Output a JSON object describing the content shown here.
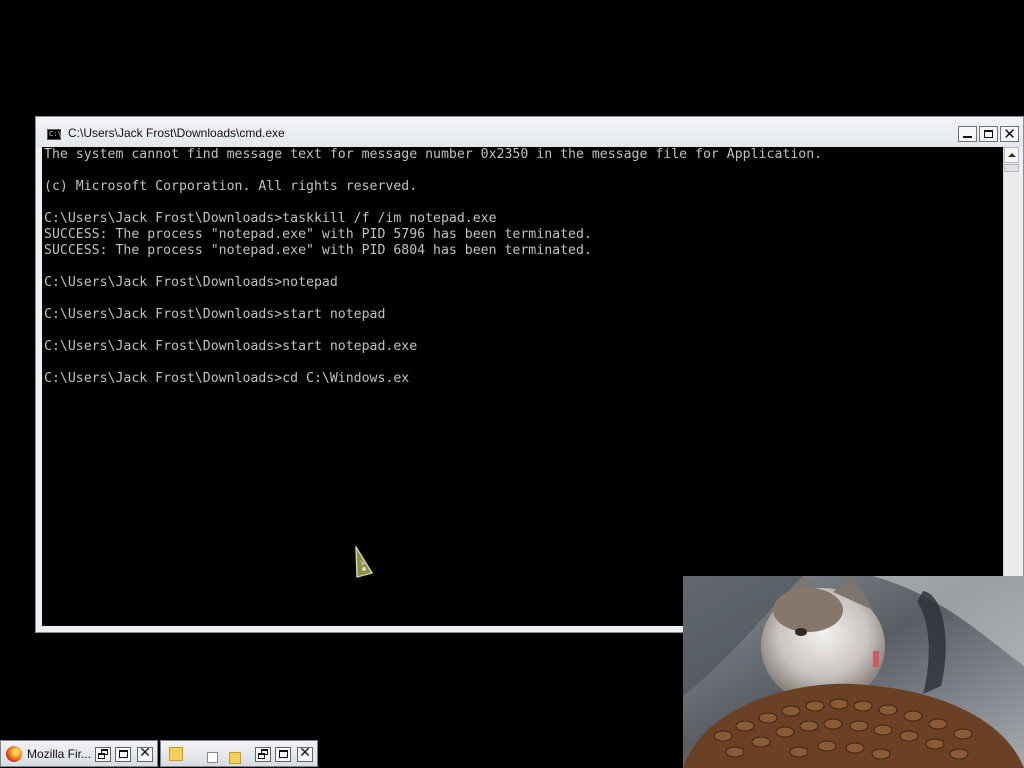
{
  "window": {
    "title": "C:\\Users\\Jack Frost\\Downloads\\cmd.exe",
    "icon_text": "C:\\",
    "minimize_symbol": "",
    "close_symbol": "✕"
  },
  "console": {
    "lines": [
      "The system cannot find message text for message number 0x2350 in the message file for Application.",
      "",
      "(c) Microsoft Corporation. All rights reserved.",
      "",
      "C:\\Users\\Jack Frost\\Downloads>taskkill /f /im notepad.exe",
      "SUCCESS: The process \"notepad.exe\" with PID 5796 has been terminated.",
      "SUCCESS: The process \"notepad.exe\" with PID 6804 has been terminated.",
      "",
      "C:\\Users\\Jack Frost\\Downloads>notepad",
      "",
      "C:\\Users\\Jack Frost\\Downloads>start notepad",
      "",
      "C:\\Users\\Jack Frost\\Downloads>start notepad.exe",
      "",
      "C:\\Users\\Jack Frost\\Downloads>cd C:\\Windows.ex"
    ],
    "text_color": "#c0c0c0",
    "background": "#000000"
  },
  "taskbar": {
    "firefox": {
      "label": "Mozilla Fir...",
      "icon": "firefox-icon"
    },
    "explorer": {
      "icon": "folder-icon"
    },
    "close_symbol": "✕"
  },
  "overlay": {
    "description_icon": "cat-video-icon"
  }
}
